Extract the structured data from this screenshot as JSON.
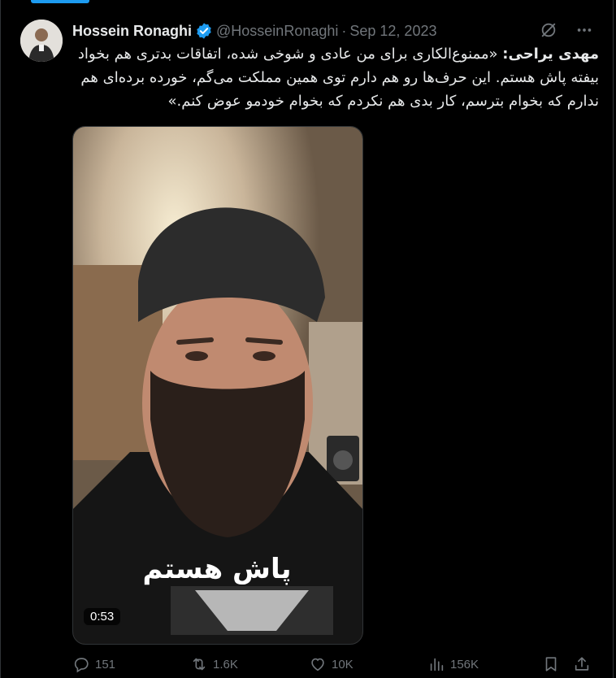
{
  "tweet": {
    "author_name": "Hossein Ronaghi",
    "handle": "@HosseinRonaghi",
    "separator": "·",
    "date": "Sep 12, 2023",
    "speaker": "مهدی یراحی:",
    "text": "«ممنوع‌الکاری برای من عادی و شوخی شده، اتفاقات بدتری هم بخواد بیفته پاش هستم. این حرف‌ها رو هم دارم توی همین مملکت می‌گم، خورده برده‌ای هم ندارم که بخوام بترسم، کار بدی هم نکردم که بخوام خودمو عوض کنم.»",
    "verified": true,
    "accent_color": "#1d9bf0"
  },
  "media": {
    "caption": "پاش هستم",
    "duration": "0:53"
  },
  "actions": {
    "replies": "151",
    "reposts": "1.6K",
    "likes": "10K",
    "views": "156K"
  },
  "icons": {
    "grok": "grok-icon",
    "more": "more-icon",
    "reply": "reply-icon",
    "repost": "repost-icon",
    "like": "like-icon",
    "views": "views-icon",
    "bookmark": "bookmark-icon",
    "share": "share-icon"
  }
}
